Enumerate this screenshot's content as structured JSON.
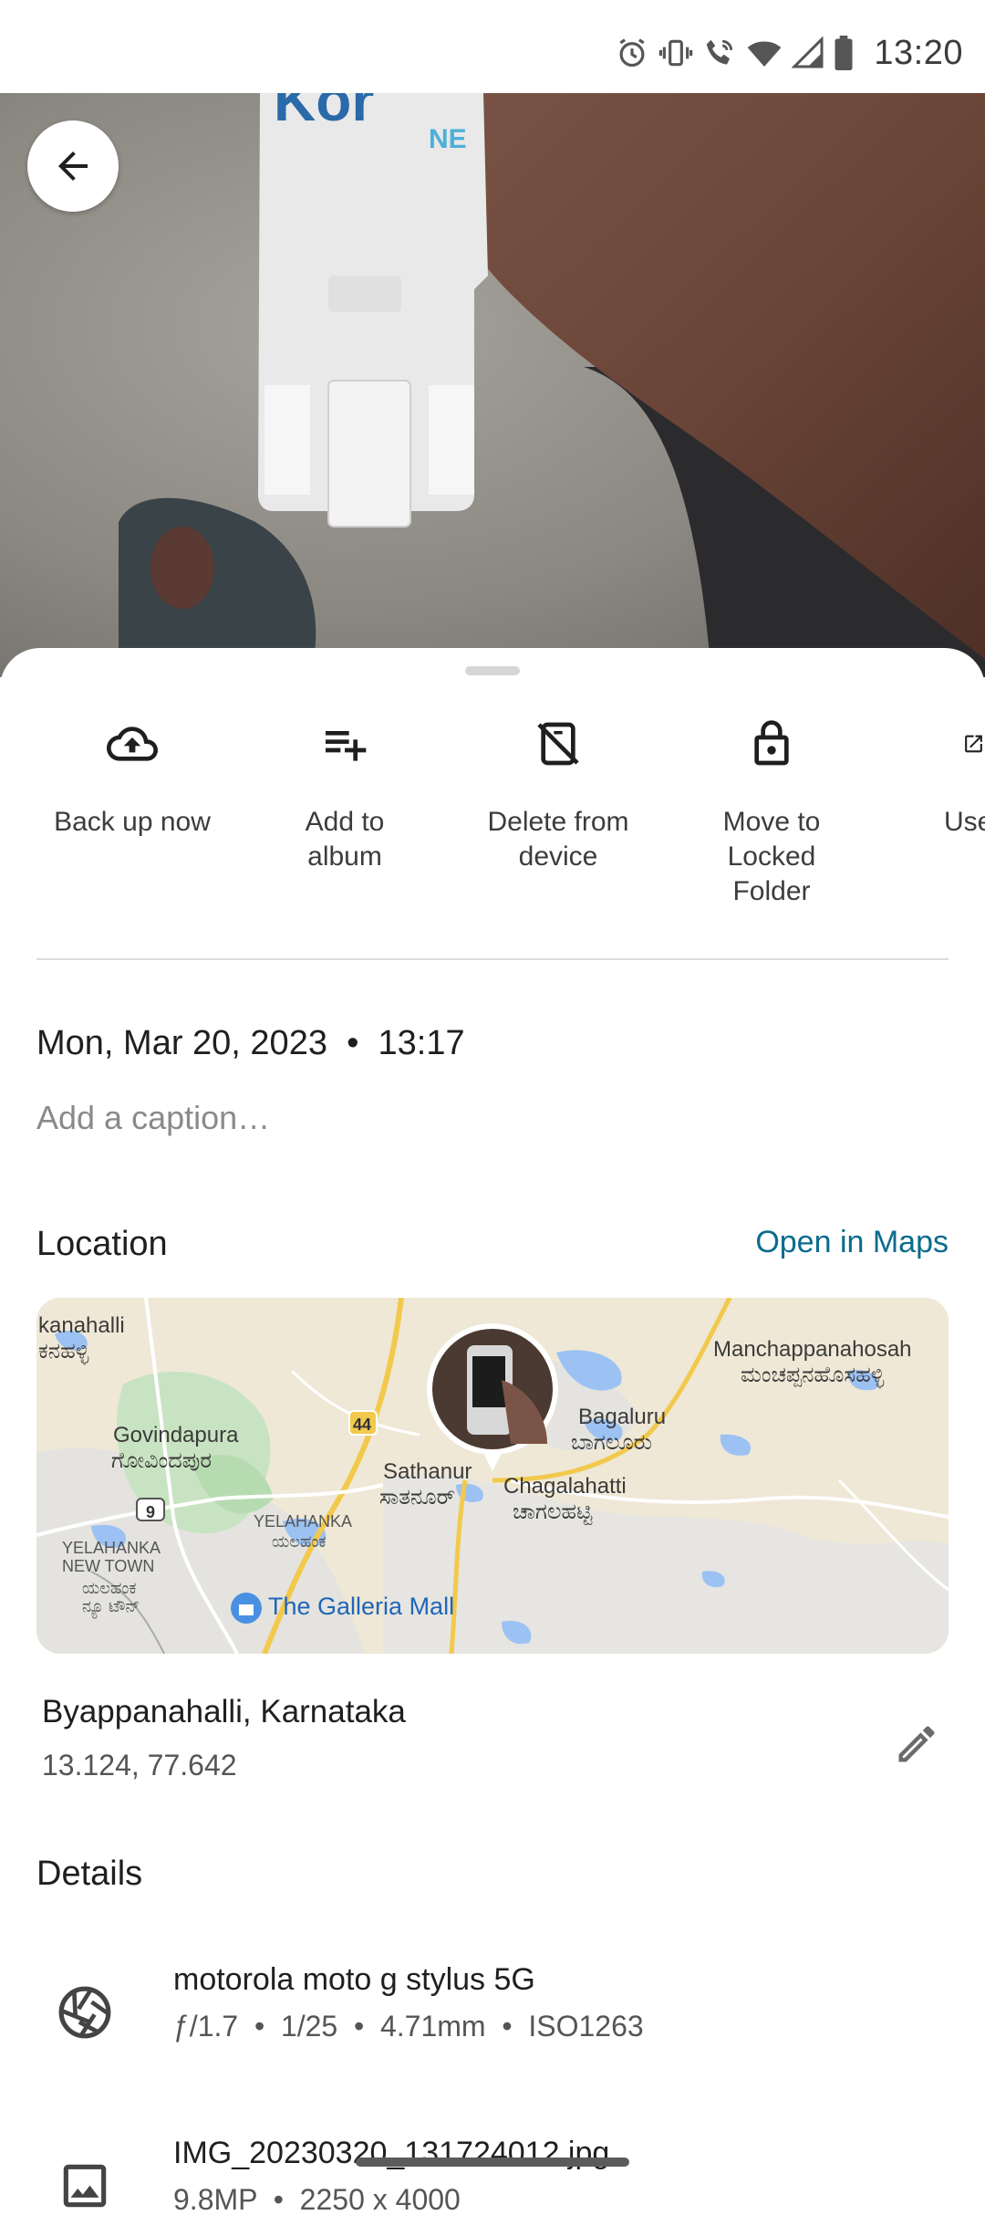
{
  "status_bar": {
    "time": "13:20",
    "icons": [
      "alarm-icon",
      "vibrate-icon",
      "wifi-call-icon",
      "wifi-icon",
      "signal-icon",
      "battery-icon"
    ]
  },
  "photo": {
    "back_label": "Back"
  },
  "actions": [
    {
      "label": "Back up now",
      "icon": "cloud-upload-icon"
    },
    {
      "label": "Add to album",
      "icon": "playlist-add-icon"
    },
    {
      "label": "Delete from device",
      "icon": "phone-off-icon"
    },
    {
      "label": "Move to Locked Folder",
      "icon": "lock-icon"
    },
    {
      "label": "Use",
      "icon": "open-icon"
    }
  ],
  "info": {
    "datetime": "Mon, Mar 20, 2023  •  13:17",
    "caption_placeholder": "Add a caption…"
  },
  "location": {
    "title": "Location",
    "open_in_maps": "Open in Maps",
    "place_name": "Byappanahalli, Karnataka",
    "coords": "13.124, 77.642",
    "map_labels": {
      "kanahalli": "kanahalli",
      "kanahalli_kn": "ಕನಹಳ್ಳಿ",
      "manchappanahosah": "Manchappanahosah",
      "manchappanahosah_kn": "ಮಂಚಪ್ಪನಹೊಸಹಳ್ಳಿ",
      "govindapura": "Govindapura",
      "govindapura_kn": "ಗೋವಿಂದಪುರ",
      "bagaluru": "Bagaluru",
      "bagaluru_kn": "ಬಾಗಲೂರು",
      "sathanur": "Sathanur",
      "sathanur_kn": "ಸಾತನೂರ್",
      "chagalahatti": "Chagalahatti",
      "chagalahatti_kn": "ಚಾಗಲಹಟ್ಟಿ",
      "yelahanka": "YELAHANKA",
      "yelahanka_kn": "ಯಲಹಂಕ",
      "yelahanka_newtown": "YELAHANKA NEW TOWN",
      "yelahanka_newtown_kn": "ಯಲಹಂಕ ನ್ಯೂ ಟೌನ್",
      "galleria": "The Galleria Mall",
      "route_44": "44",
      "route_9": "9"
    }
  },
  "details": {
    "title": "Details",
    "camera": {
      "model": "motorola moto g stylus 5G",
      "specs": "ƒ/1.7  •  1/25  •  4.71mm  •  ISO1263",
      "icon": "aperture-icon"
    },
    "file": {
      "name": "IMG_20230320_131724012.jpg",
      "specs": "9.8MP  •  2250 x 4000",
      "icon": "image-icon"
    }
  }
}
